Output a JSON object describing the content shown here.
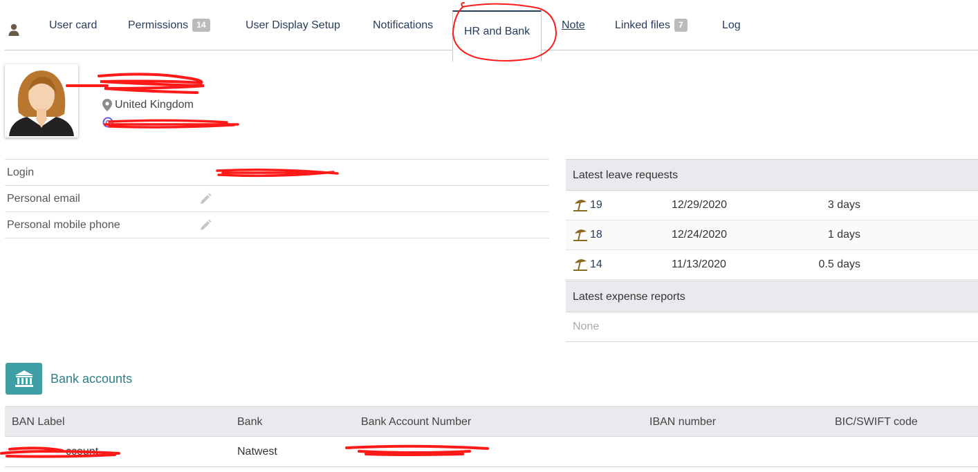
{
  "tabs": [
    {
      "label": "User card",
      "badge": null
    },
    {
      "label": "Permissions",
      "badge": "14"
    },
    {
      "label": "User Display Setup",
      "badge": null
    },
    {
      "label": "Notifications",
      "badge": null
    },
    {
      "label": "HR and Bank",
      "badge": null,
      "active": true
    },
    {
      "label": "Note",
      "badge": null
    },
    {
      "label": "Linked files",
      "badge": "7"
    },
    {
      "label": "Log",
      "badge": null
    }
  ],
  "profile": {
    "location": "United Kingdom"
  },
  "info": {
    "login_label": "Login",
    "personal_email_label": "Personal email",
    "personal_mobile_label": "Personal mobile phone"
  },
  "leave": {
    "title": "Latest leave requests",
    "rows": [
      {
        "id": "19",
        "date": "12/29/2020",
        "duration": "3 days"
      },
      {
        "id": "18",
        "date": "12/24/2020",
        "duration": "1 days"
      },
      {
        "id": "14",
        "date": "11/13/2020",
        "duration": "0.5 days"
      }
    ]
  },
  "expense": {
    "title": "Latest expense reports",
    "none": "None"
  },
  "bank": {
    "title": "Bank accounts",
    "columns": [
      "BAN Label",
      "Bank",
      "Bank Account Number",
      "IBAN number",
      "BIC/SWIFT code"
    ],
    "rows": [
      {
        "label_visible": "ccount",
        "bank": "Natwest"
      }
    ]
  },
  "colors": {
    "tab_text": "#263c5c",
    "accent_teal": "#3e9ea5",
    "bank_title": "#2f7e87",
    "header_bg": "#e9eaed",
    "annotation_red": "#ff1a1a"
  },
  "icons": {
    "user": "user-icon",
    "location": "map-marker-icon",
    "email": "at-icon",
    "edit": "pencil-icon",
    "leave": "beach-umbrella-icon",
    "bank": "bank-building-icon"
  }
}
